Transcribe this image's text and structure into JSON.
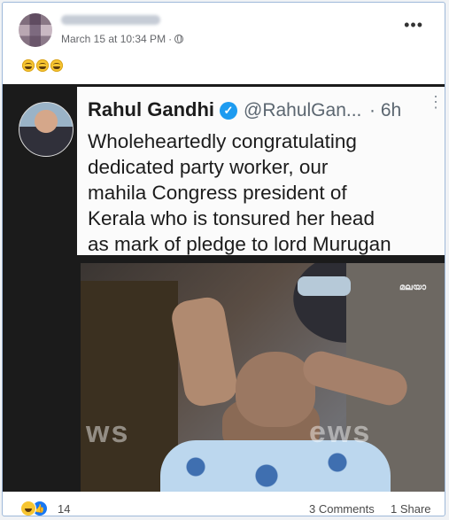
{
  "post": {
    "timestamp": "March 15 at 10:34 PM",
    "separator": "·",
    "more_label": "•••",
    "emoji_reaction_text": "😁😁😁"
  },
  "tweet": {
    "name": "Rahul Gandhi",
    "verified_glyph": "✓",
    "handle": "@RahulGan...",
    "time": "· 6h",
    "more_label": "⋮",
    "lines": [
      "Wholeheartedly congratulating",
      "dedicated party worker, our",
      "mahila Congress president of",
      "Kerala who is tonsured her head",
      "as mark of pledge to lord Murugan"
    ]
  },
  "photo": {
    "watermark_left": "ws",
    "watermark_right": "ews",
    "logo_text": "മലയാ"
  },
  "footer": {
    "reaction_count": "14",
    "like_glyph": "👍",
    "comments": "3 Comments",
    "shares": "1 Share"
  },
  "colors": {
    "card_border": "#9fb9d9",
    "meta_text": "#65676b",
    "verified_blue": "#1d9bf0",
    "like_blue": "#1877f2"
  }
}
